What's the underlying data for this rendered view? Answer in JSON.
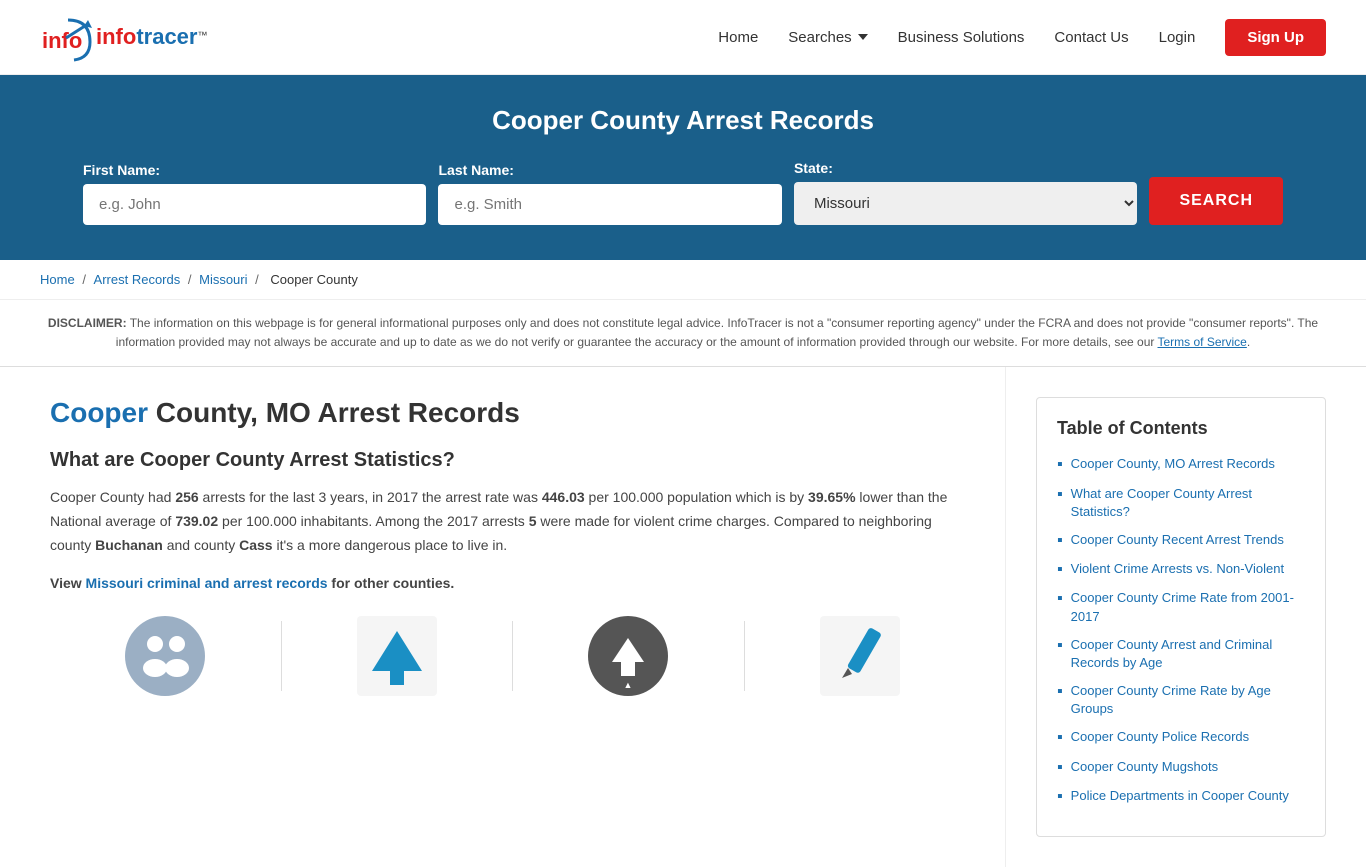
{
  "header": {
    "logo_info": "info",
    "logo_tracer": "tracer",
    "logo_tm": "™",
    "nav": {
      "home": "Home",
      "searches": "Searches",
      "business_solutions": "Business Solutions",
      "contact_us": "Contact Us",
      "login": "Login",
      "signup": "Sign Up"
    }
  },
  "hero": {
    "title": "Cooper County Arrest Records",
    "form": {
      "first_name_label": "First Name:",
      "first_name_placeholder": "e.g. John",
      "last_name_label": "Last Name:",
      "last_name_placeholder": "e.g. Smith",
      "state_label": "State:",
      "state_value": "Missouri",
      "search_button": "SEARCH"
    }
  },
  "breadcrumb": {
    "home": "Home",
    "arrest_records": "Arrest Records",
    "missouri": "Missouri",
    "cooper_county": "Cooper County"
  },
  "disclaimer": {
    "label": "DISCLAIMER:",
    "text": "The information on this webpage is for general informational purposes only and does not constitute legal advice. InfoTracer is not a \"consumer reporting agency\" under the FCRA and does not provide \"consumer reports\". The information provided may not always be accurate and up to date as we do not verify or guarantee the accuracy or the amount of information provided through our website. For more details, see our",
    "link_text": "Terms of Service",
    "period": "."
  },
  "article": {
    "h2_highlight": "Cooper",
    "h2_rest": " County, MO Arrest Records",
    "h3_stats": "What are Cooper County Arrest Statistics?",
    "p1_start": "Cooper County had ",
    "p1_arrests": "256",
    "p1_mid1": " arrests for the last 3 years, in 2017 the arrest rate was ",
    "p1_rate": "446.03",
    "p1_mid2": " per 100.000 population which is by ",
    "p1_pct": "39.65%",
    "p1_mid3": " lower than the National average of ",
    "p1_nat": "739.02",
    "p1_mid4": " per 100.000 inhabitants. Among the 2017 arrests ",
    "p1_violent": "5",
    "p1_mid5": " were made for violent crime charges. Compared to neighboring county ",
    "p1_buchanan": "Buchanan",
    "p1_mid6": " and county ",
    "p1_cass": "Cass",
    "p1_end": " it's a more dangerous place to live in.",
    "p2_start": "View ",
    "p2_link": "Missouri criminal and arrest records",
    "p2_end": " for other counties."
  },
  "toc": {
    "title": "Table of Contents",
    "items": [
      {
        "label": "Cooper County, MO Arrest Records"
      },
      {
        "label": "What are Cooper County Arrest Statistics?"
      },
      {
        "label": "Cooper County Recent Arrest Trends"
      },
      {
        "label": "Violent Crime Arrests vs. Non-Violent"
      },
      {
        "label": "Cooper County Crime Rate from 2001-2017"
      },
      {
        "label": "Cooper County Arrest and Criminal Records by Age"
      },
      {
        "label": "Cooper County Crime Rate by Age Groups"
      },
      {
        "label": "Cooper County Police Records"
      },
      {
        "label": "Cooper County Mugshots"
      },
      {
        "label": "Police Departments in Cooper County"
      }
    ]
  }
}
